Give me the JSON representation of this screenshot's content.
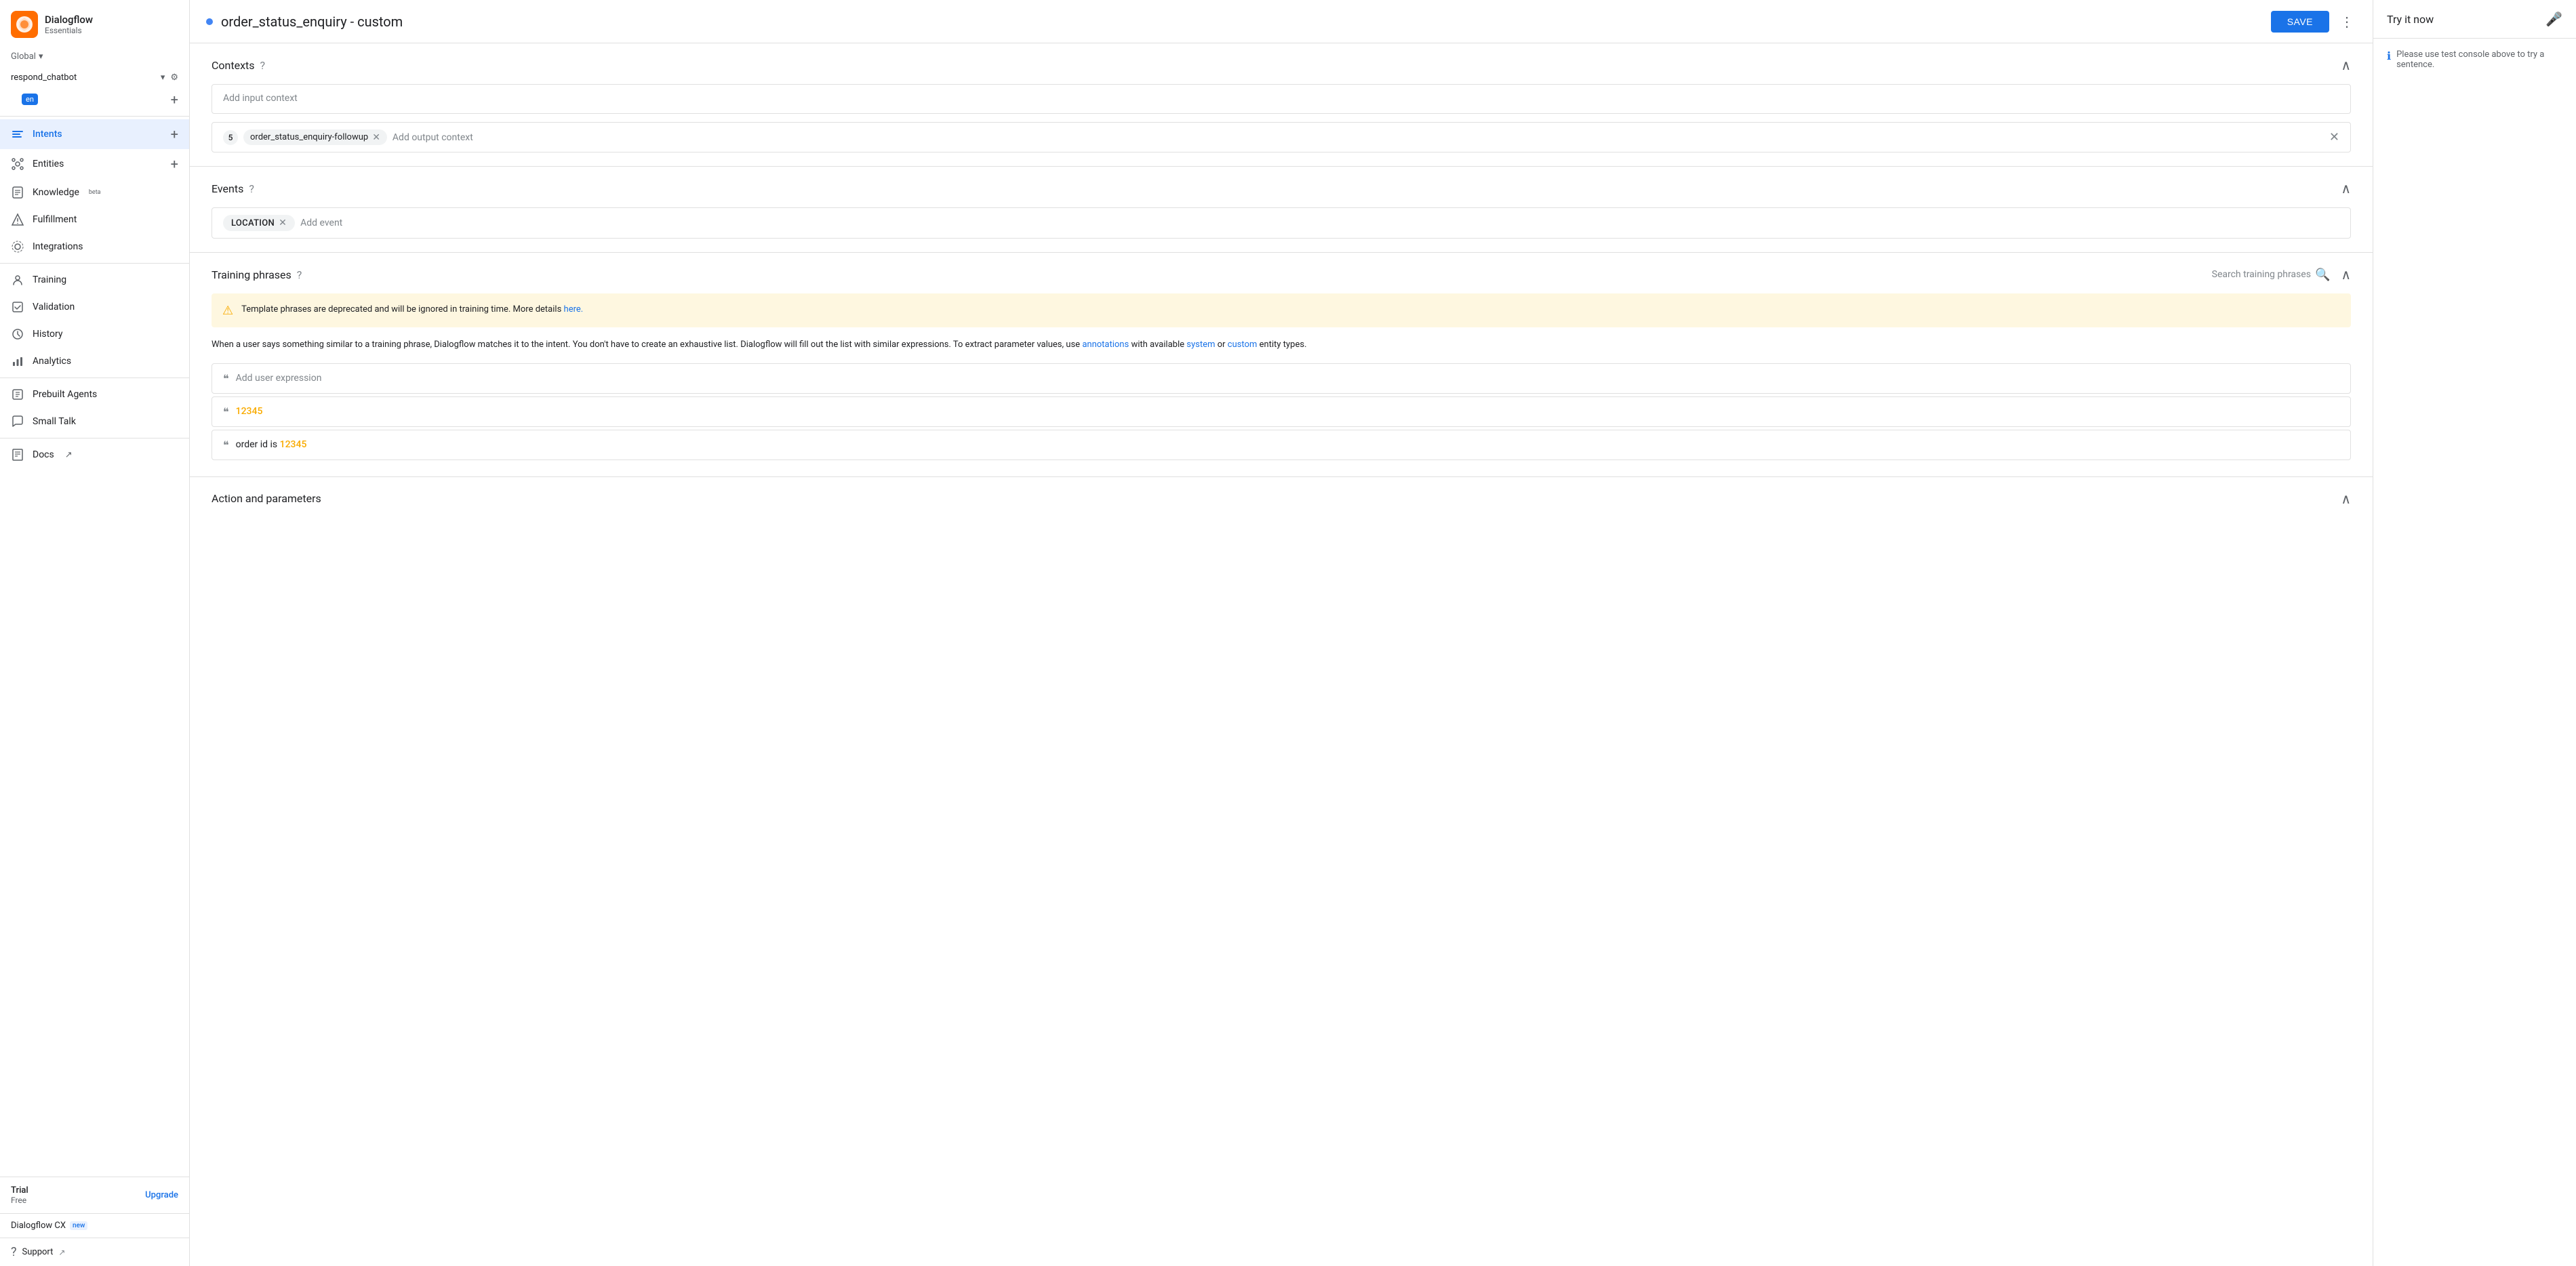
{
  "sidebar": {
    "logo": {
      "title": "Dialogflow",
      "subtitle": "Essentials"
    },
    "global_label": "Global",
    "agent_name": "respond_chatbot",
    "language": "en",
    "nav_items": [
      {
        "id": "intents",
        "label": "Intents",
        "active": true,
        "has_add": true
      },
      {
        "id": "entities",
        "label": "Entities",
        "active": false,
        "has_add": true
      },
      {
        "id": "knowledge",
        "label": "Knowledge",
        "active": false,
        "has_add": false,
        "badge": "beta"
      },
      {
        "id": "fulfillment",
        "label": "Fulfillment",
        "active": false
      },
      {
        "id": "integrations",
        "label": "Integrations",
        "active": false
      },
      {
        "id": "training",
        "label": "Training",
        "active": false
      },
      {
        "id": "validation",
        "label": "Validation",
        "active": false
      },
      {
        "id": "history",
        "label": "History",
        "active": false
      },
      {
        "id": "analytics",
        "label": "Analytics",
        "active": false
      },
      {
        "id": "prebuilt-agents",
        "label": "Prebuilt Agents",
        "active": false
      },
      {
        "id": "small-talk",
        "label": "Small Talk",
        "active": false
      },
      {
        "id": "docs",
        "label": "Docs",
        "active": false,
        "external": true
      }
    ],
    "trial": {
      "label": "Trial",
      "sublabel": "Free",
      "upgrade_label": "Upgrade"
    },
    "dialogflow_cx": {
      "label": "Dialogflow CX",
      "badge": "new"
    },
    "support": {
      "label": "Support"
    }
  },
  "topbar": {
    "intent_name": "order_status_enquiry - custom",
    "save_label": "SAVE"
  },
  "try_it": {
    "label": "Try it now",
    "hint": "Please use test console above to try a sentence."
  },
  "contexts": {
    "title": "Contexts",
    "input_placeholder": "Add input context",
    "output_number": "5",
    "output_tag": "order_status_enquiry-followup",
    "output_placeholder": "Add output context"
  },
  "events": {
    "title": "Events",
    "tag": "LOCATION",
    "add_placeholder": "Add event"
  },
  "training_phrases": {
    "title": "Training phrases",
    "search_placeholder": "Search training phrases",
    "warning": {
      "text": "Template phrases are deprecated and will be ignored in training time. More details",
      "link_text": "here.",
      "link_url": "#"
    },
    "info": {
      "text": "When a user says something similar to a training phrase, Dialogflow matches it to the intent. You don't have to create an exhaustive list. Dialogflow will fill out the list with similar expressions. To extract parameter values, use",
      "link1_text": "annotations",
      "middle_text": "with available",
      "link2_text": "system",
      "or_text": "or",
      "link3_text": "custom",
      "end_text": "entity types."
    },
    "add_placeholder": "Add user expression",
    "phrases": [
      {
        "id": 1,
        "text": "12345",
        "highlight": "12345"
      },
      {
        "id": 2,
        "text_before": "order id is ",
        "highlight": "12345",
        "text_after": ""
      }
    ]
  },
  "action_parameters": {
    "title": "Action and parameters"
  },
  "colors": {
    "accent": "#1a73e8",
    "warning": "#f9ab00",
    "warning_bg": "#fef7e0",
    "active_bg": "#e8f0fe",
    "status_blue": "#4285f4"
  }
}
